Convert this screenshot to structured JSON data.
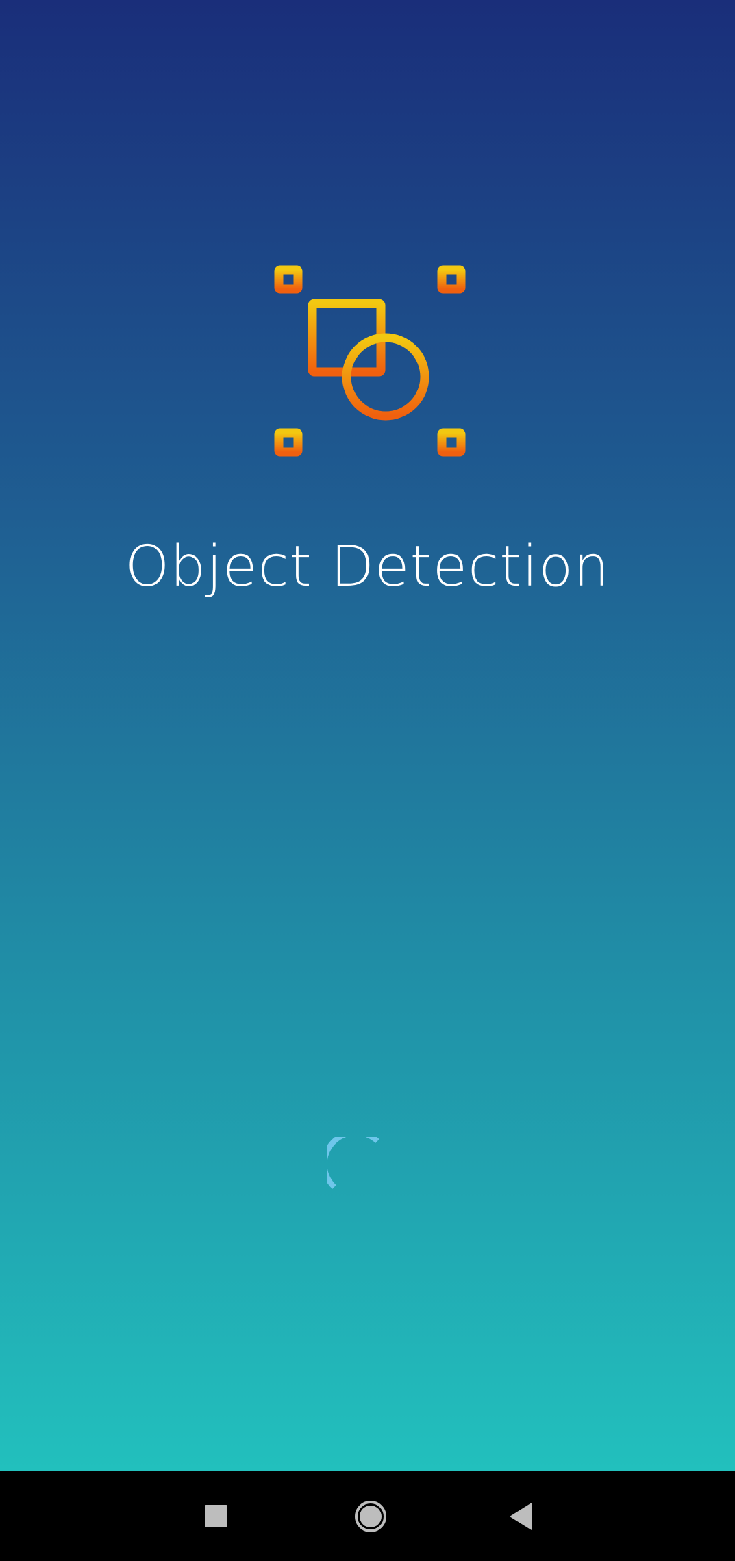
{
  "app": {
    "title": "Object Detection",
    "logo_icon": "object-detection-icon",
    "logo_colors": {
      "top": "#f2c811",
      "bottom": "#f0600f"
    },
    "background_colors": {
      "top": "#1a2e7a",
      "bottom": "#22c0bd"
    },
    "spinner_color": "#6ec6ea"
  },
  "navbar": {
    "buttons": [
      {
        "icon": "recents-square-icon"
      },
      {
        "icon": "home-circle-icon"
      },
      {
        "icon": "back-triangle-icon"
      }
    ]
  }
}
